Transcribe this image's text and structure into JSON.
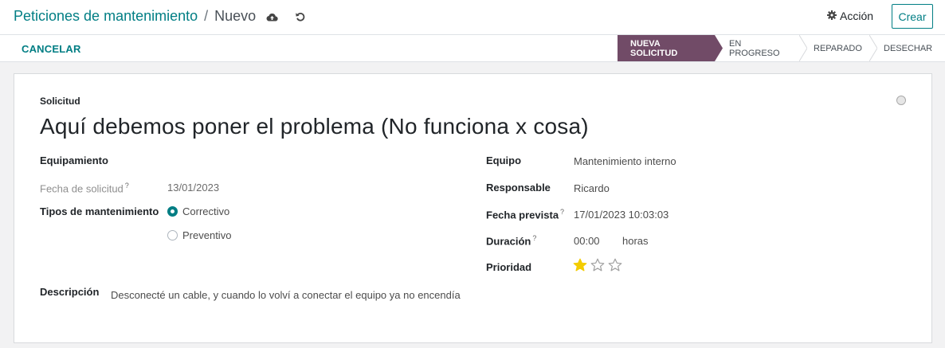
{
  "breadcrumb": {
    "parent": "Peticiones de mantenimiento",
    "separator": "/",
    "current": "Nuevo"
  },
  "icons": {
    "save": "cloud-upload-icon",
    "discard": "undo-icon",
    "action": "gear-icon",
    "kanban_state": "status-circle-icon",
    "priority": "star-icon"
  },
  "toolbar": {
    "action_label": "Acción",
    "create_label": "Crear"
  },
  "statusbar": {
    "cancel_label": "CANCELAR",
    "stages": [
      {
        "label": "NUEVA SOLICITUD",
        "active": true
      },
      {
        "label": "EN PROGRESO",
        "active": false
      },
      {
        "label": "REPARADO",
        "active": false
      },
      {
        "label": "DESECHAR",
        "active": false
      }
    ]
  },
  "form": {
    "request_label": "Solicitud",
    "request_title": "Aquí debemos poner el problema (No funciona x cosa)",
    "equipment_label": "Equipamiento",
    "request_date_label": "Fecha de solicitud",
    "request_date_help": "?",
    "request_date_value": "13/01/2023",
    "maintenance_type_label": "Tipos de mantenimiento",
    "maintenance_type_options": [
      {
        "label": "Correctivo",
        "checked": true
      },
      {
        "label": "Preventivo",
        "checked": false
      }
    ],
    "team_label": "Equipo",
    "team_value": "Mantenimiento interno",
    "responsible_label": "Responsable",
    "responsible_value": "Ricardo",
    "scheduled_date_label": "Fecha prevista",
    "scheduled_date_help": "?",
    "scheduled_date_value": "17/01/2023 10:03:03",
    "duration_label": "Duración",
    "duration_help": "?",
    "duration_value": "00:00",
    "duration_unit": "horas",
    "priority_label": "Prioridad",
    "priority_value": 1,
    "priority_max": 3,
    "description_label": "Descripción",
    "description_value": "Desconecté un cable, y cuando lo volví a conectar el equipo ya no encendía"
  },
  "colors": {
    "brand": "#714b67",
    "accent": "#017e84",
    "star_filled": "#f3cc00",
    "star_empty": "#a0a0a0"
  }
}
